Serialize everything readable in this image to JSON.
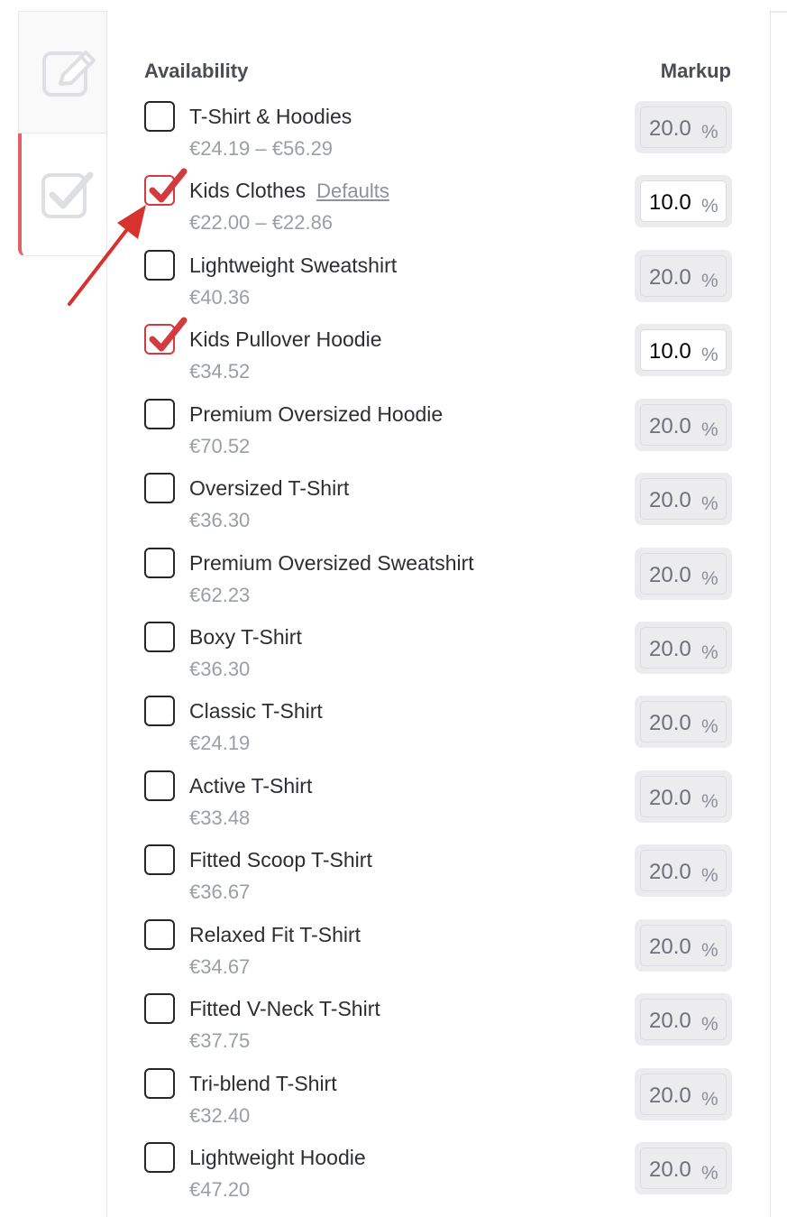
{
  "headers": {
    "availability": "Availability",
    "markup": "Markup"
  },
  "defaults_link": "Defaults",
  "colors": {
    "accent_red": "#d33b3f",
    "tab_accent": "#e06169",
    "arrow": "#d7322d"
  },
  "icons": {
    "edit_tab": "pencil-square-icon",
    "availability_tab": "check-square-icon"
  },
  "products": [
    {
      "name": "T-Shirt & Hoodies",
      "price": "€24.19 – €56.29",
      "checked": false,
      "markup": "20.0",
      "unit": "%"
    },
    {
      "name": "Kids Clothes",
      "price": "€22.00 – €22.86",
      "checked": true,
      "markup": "10.0",
      "unit": "%",
      "link": "Defaults"
    },
    {
      "name": "Lightweight Sweatshirt",
      "price": "€40.36",
      "checked": false,
      "markup": "20.0",
      "unit": "%"
    },
    {
      "name": "Kids Pullover Hoodie",
      "price": "€34.52",
      "checked": true,
      "markup": "10.0",
      "unit": "%"
    },
    {
      "name": "Premium Oversized Hoodie",
      "price": "€70.52",
      "checked": false,
      "markup": "20.0",
      "unit": "%"
    },
    {
      "name": "Oversized T-Shirt",
      "price": "€36.30",
      "checked": false,
      "markup": "20.0",
      "unit": "%"
    },
    {
      "name": "Premium Oversized Sweatshirt",
      "price": "€62.23",
      "checked": false,
      "markup": "20.0",
      "unit": "%"
    },
    {
      "name": "Boxy T-Shirt",
      "price": "€36.30",
      "checked": false,
      "markup": "20.0",
      "unit": "%"
    },
    {
      "name": "Classic T-Shirt",
      "price": "€24.19",
      "checked": false,
      "markup": "20.0",
      "unit": "%"
    },
    {
      "name": "Active T-Shirt",
      "price": "€33.48",
      "checked": false,
      "markup": "20.0",
      "unit": "%"
    },
    {
      "name": "Fitted Scoop T-Shirt",
      "price": "€36.67",
      "checked": false,
      "markup": "20.0",
      "unit": "%"
    },
    {
      "name": "Relaxed Fit T-Shirt",
      "price": "€34.67",
      "checked": false,
      "markup": "20.0",
      "unit": "%"
    },
    {
      "name": "Fitted V-Neck T-Shirt",
      "price": "€37.75",
      "checked": false,
      "markup": "20.0",
      "unit": "%"
    },
    {
      "name": "Tri-blend T-Shirt",
      "price": "€32.40",
      "checked": false,
      "markup": "20.0",
      "unit": "%"
    },
    {
      "name": "Lightweight Hoodie",
      "price": "€47.20",
      "checked": false,
      "markup": "20.0",
      "unit": "%"
    }
  ]
}
